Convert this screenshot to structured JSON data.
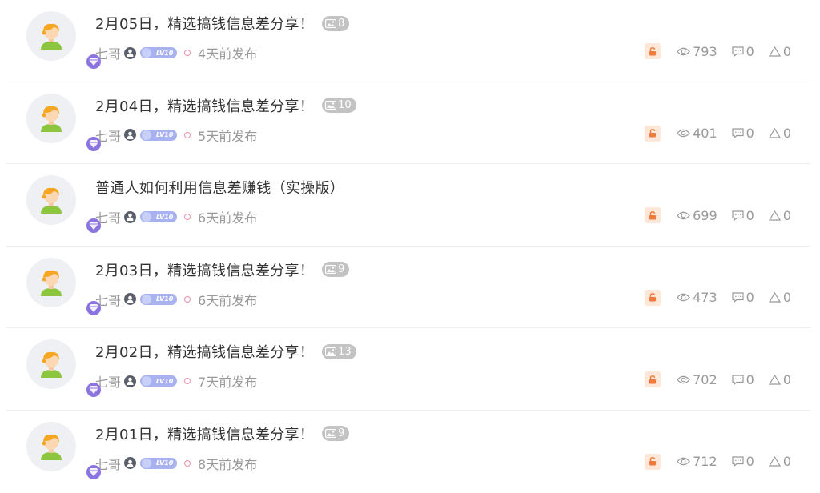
{
  "colors": {
    "lock_bg": "#fde7d9",
    "lock_fg": "#f07a3a",
    "vip_purple": "#8b74e0",
    "level_badge": "#a8b2f0",
    "dot_pink": "#f08fa6",
    "muted_text": "#999999"
  },
  "posts": [
    {
      "title": "2月05日，精选搞钱信息差分享！",
      "image_count": "8",
      "author": "七哥",
      "level": "LV10",
      "time": "4天前发布",
      "views": "793",
      "comments": "0",
      "likes": "0"
    },
    {
      "title": "2月04日，精选搞钱信息差分享！",
      "image_count": "10",
      "author": "七哥",
      "level": "LV10",
      "time": "5天前发布",
      "views": "401",
      "comments": "0",
      "likes": "0"
    },
    {
      "title": "普通人如何利用信息差赚钱（实操版）",
      "image_count": null,
      "author": "七哥",
      "level": "LV10",
      "time": "6天前发布",
      "views": "699",
      "comments": "0",
      "likes": "0"
    },
    {
      "title": "2月03日，精选搞钱信息差分享！",
      "image_count": "9",
      "author": "七哥",
      "level": "LV10",
      "time": "6天前发布",
      "views": "473",
      "comments": "0",
      "likes": "0"
    },
    {
      "title": "2月02日，精选搞钱信息差分享！",
      "image_count": "13",
      "author": "七哥",
      "level": "LV10",
      "time": "7天前发布",
      "views": "702",
      "comments": "0",
      "likes": "0"
    },
    {
      "title": "2月01日，精选搞钱信息差分享！",
      "image_count": "9",
      "author": "七哥",
      "level": "LV10",
      "time": "8天前发布",
      "views": "712",
      "comments": "0",
      "likes": "0"
    }
  ]
}
